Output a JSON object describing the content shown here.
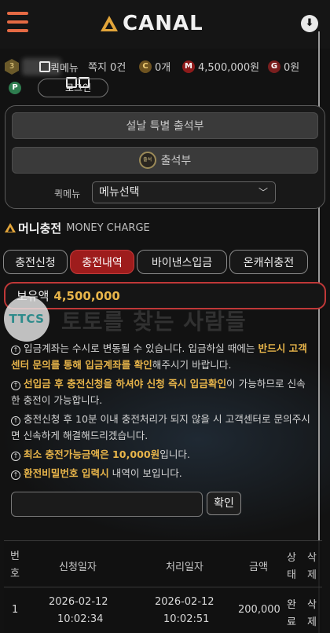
{
  "header": {
    "logo_text": "CANAL",
    "menu_icon": "hamburger-icon",
    "scroll_icon": "chevron-down-circle-icon"
  },
  "status": {
    "level": "3",
    "quick_menu_text": "퀵메뉴",
    "notice_text": "쪽지 0건",
    "coin_label": "0개",
    "money_label": "4,500,000원",
    "g_label": "0원",
    "c_letter": "C",
    "m_letter": "M",
    "g_letter": "G",
    "p_letter": "P",
    "pill_text": "로그인"
  },
  "attendance": {
    "special_btn": "설날 특별 출석부",
    "attendance_btn": "출석부",
    "coin_text": "출석",
    "quick_menu_label": "퀵메뉴",
    "select_value": "메뉴선택"
  },
  "section": {
    "title_ko": "머니충전",
    "title_en": "MONEY CHARGE"
  },
  "tabs": [
    {
      "label": "충전신청"
    },
    {
      "label": "충전내역"
    },
    {
      "label": "바이낸스입금"
    },
    {
      "label": "온캐쉬충전"
    }
  ],
  "balance": {
    "label": "보유액",
    "value": "4,500,000"
  },
  "watermark": {
    "badge": "TTCS",
    "text": "토토를 찾는 사람들"
  },
  "notices": {
    "n1_a": "입금계좌는 수시로 변동될 수 있습니다. 입금하실 때에는 ",
    "n1_hl": "반드시 고객센터 문의를 통해 입금계좌를 확인",
    "n1_b": "해주시기 바랍니다.",
    "n2_hl": "선입금 후 충전신청을 하셔야 신청 즉시 입금확인",
    "n2_b": "이 가능하므로 신속한 충전이 가능합니다.",
    "n3": "충전신청 후 10분 이내 충전처리가 되지 않을 시 고객센터로 문의주시면 신속하게 해결해드리겠습니다.",
    "n4_hl": "최소 충전가능금액은 10,000원",
    "n4_b": "입니다.",
    "n5_hl": "환전비밀번호 입력시",
    "n5_b": " 내역이 보입니다."
  },
  "password": {
    "placeholder": "",
    "confirm_label": "확인"
  },
  "table": {
    "headers": {
      "no_1": "번",
      "no_2": "호",
      "request_date": "신청일자",
      "process_date": "처리일자",
      "amount": "금액",
      "status_1": "상",
      "status_2": "태",
      "delete_1": "삭",
      "delete_2": "제"
    },
    "rows": [
      {
        "no": "1",
        "request_date": "2026-02-12",
        "request_time": "10:02:34",
        "process_date": "2026-02-12",
        "process_time": "10:02:51",
        "amount": "200,000",
        "status_1": "완",
        "status_2": "료",
        "delete_1": "삭",
        "delete_2": "제"
      }
    ]
  },
  "colors": {
    "accent_orange": "#e56a44",
    "accent_gold": "#e8b54a",
    "active_tab": "#9e1c1c",
    "background": "#121212"
  }
}
